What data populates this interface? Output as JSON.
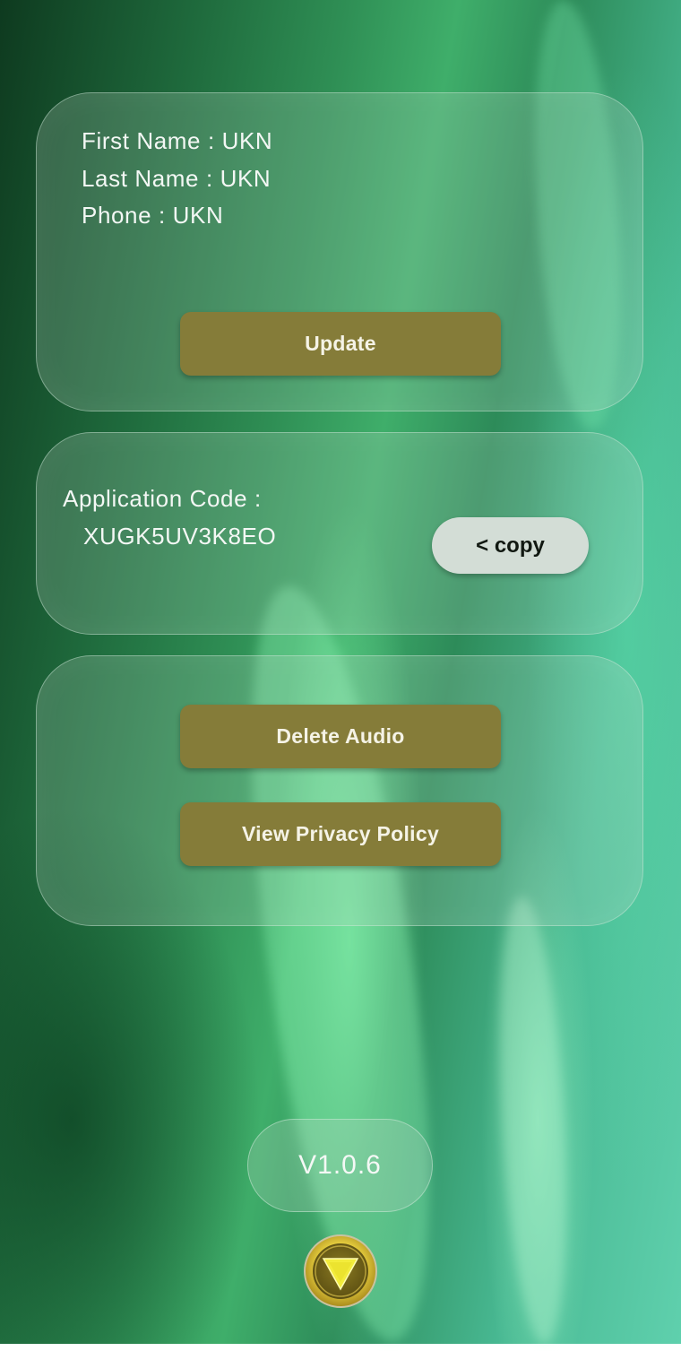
{
  "profile": {
    "first_name": "First Name : UKN",
    "last_name": "Last Name : UKN",
    "phone": "Phone : UKN",
    "update_label": "Update"
  },
  "application": {
    "code_label": "Application Code  :",
    "code_value": "XUGK5UV3K8EO",
    "copy_label": "< copy"
  },
  "actions": {
    "delete_audio_label": "Delete Audio",
    "privacy_policy_label": "View Privacy Policy"
  },
  "footer": {
    "version": "V1.0.6",
    "logo_icon": "gold-triangle-emblem-icon"
  },
  "colors": {
    "button_gold": "#857c39",
    "copy_button": "#d3ddd6",
    "background_green": "#2f8f55"
  }
}
